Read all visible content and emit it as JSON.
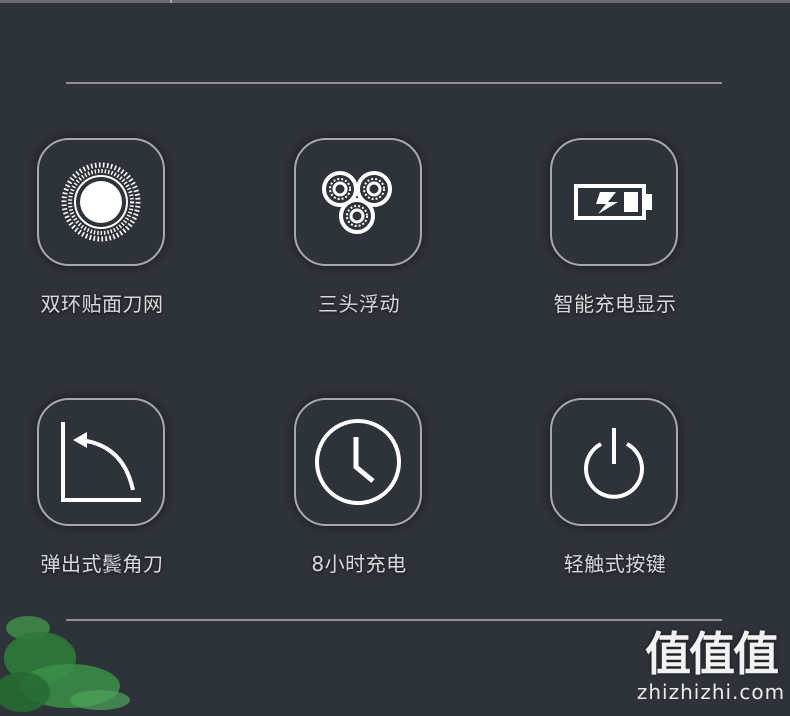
{
  "features": [
    {
      "label": "双环贴面刀网",
      "icon": "double-ring-foil-icon"
    },
    {
      "label": "三头浮动",
      "icon": "three-heads-icon"
    },
    {
      "label": "智能充电显示",
      "icon": "battery-charging-icon"
    },
    {
      "label": "弹出式鬓角刀",
      "icon": "popup-trimmer-icon"
    },
    {
      "label": "8小时充电",
      "icon": "clock-icon"
    },
    {
      "label": "轻触式按键",
      "icon": "power-icon"
    }
  ],
  "watermark": {
    "logo": "值值值",
    "site": "zhizhizhi.com"
  },
  "colors": {
    "background": "#2e3239",
    "tile_border": "#a6aab0",
    "icon": "#ffffff",
    "text": "#d7d9dc"
  }
}
